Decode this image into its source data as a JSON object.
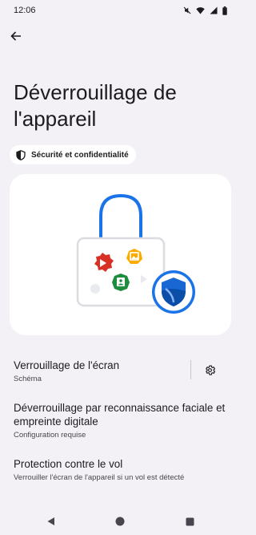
{
  "status_bar": {
    "time": "12:06",
    "icons": [
      "do-not-disturb-icon",
      "wifi-icon",
      "signal-icon",
      "battery-icon"
    ]
  },
  "header": {
    "back_icon": "arrow-back-icon",
    "title": "Déverrouillage de l'appareil"
  },
  "chip": {
    "icon": "shield-icon",
    "label": "Sécurité et confidentialité"
  },
  "illustration": {
    "description_icons": [
      "lock-icon",
      "youtube-icon",
      "photos-icon",
      "contacts-icon",
      "shield-badge-icon"
    ],
    "colors": {
      "lock_shackle": "#1a73e8",
      "lock_body_border": "#dadce0",
      "red": "#d93025",
      "yellow": "#f9ab00",
      "green": "#1e8e3e",
      "shield_blue": "#1967d2"
    }
  },
  "settings": {
    "screen_lock": {
      "title": "Verrouillage de l'écran",
      "subtitle": "Schéma",
      "gear_icon": "gear-icon"
    },
    "face_fingerprint": {
      "title": "Déverrouillage par reconnaissance faciale et empreinte digitale",
      "subtitle": "Configuration requise"
    },
    "theft_protection": {
      "title": "Protection contre le vol",
      "subtitle": "Verrouiller l'écran de l'appareil si un vol est détecté"
    }
  },
  "nav_bar": {
    "icons": [
      "nav-back-icon",
      "nav-home-icon",
      "nav-recents-icon"
    ]
  }
}
